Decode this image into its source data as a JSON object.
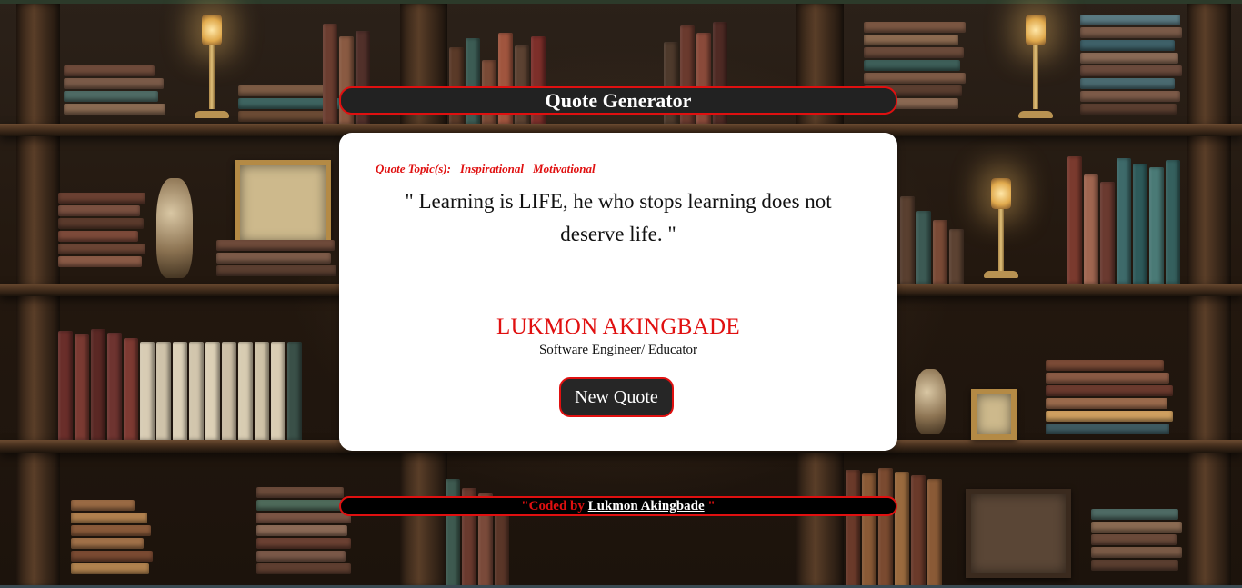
{
  "header": {
    "title": "Quote Generator"
  },
  "quote": {
    "topics_label": "Quote Topic(s):",
    "topics": [
      "Inspirational",
      "Motivational"
    ],
    "text": "\" Learning is LIFE, he who stops learning does not deserve life. \"",
    "author": "LUKMON AKINGBADE",
    "author_role": "Software Engineer/ Educator"
  },
  "actions": {
    "new_quote_label": "New Quote"
  },
  "footer": {
    "prefix": "\"Coded by ",
    "link_text": "Lukmon Akingbade",
    "suffix": " \""
  },
  "colors": {
    "accent": "#e01010",
    "bar_background": "#222222",
    "card_background": "#ffffff"
  }
}
